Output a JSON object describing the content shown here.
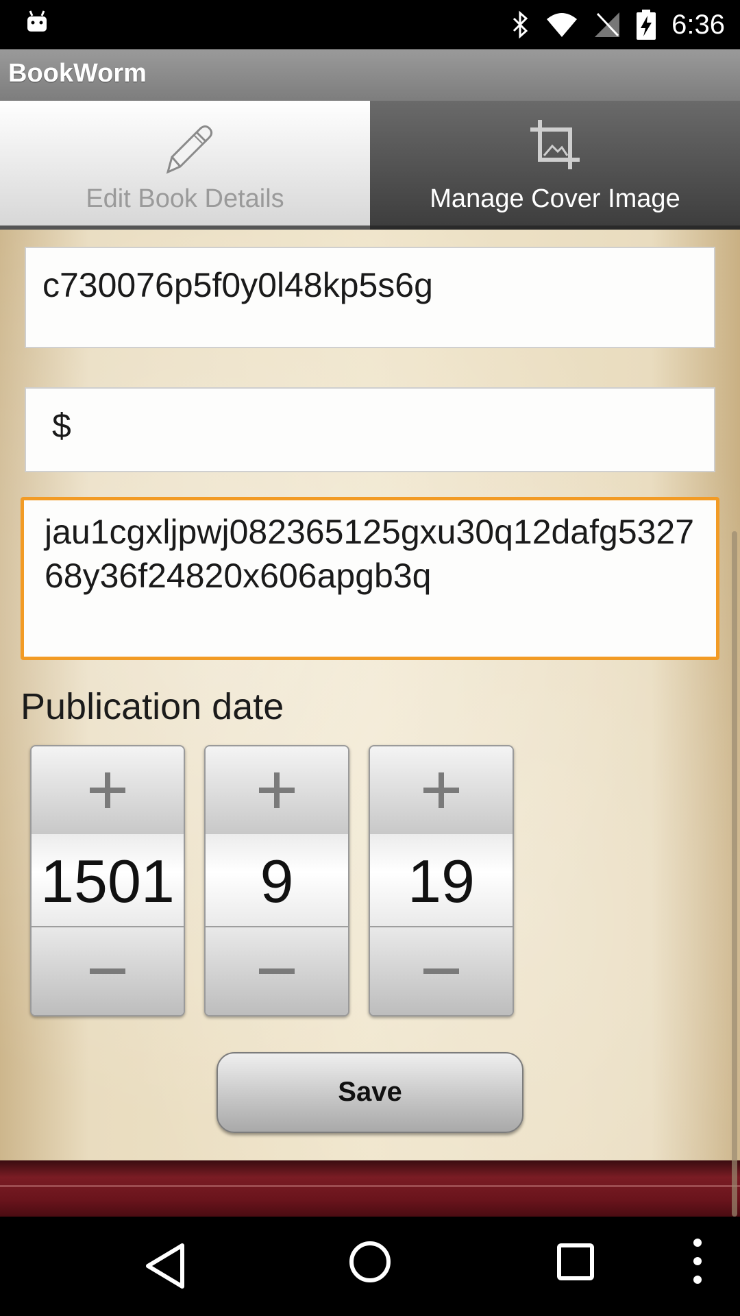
{
  "status_bar": {
    "time": "6:36",
    "icons": [
      "android-icon",
      "bluetooth-icon",
      "wifi-icon",
      "no-signal-icon",
      "battery-charging-icon"
    ]
  },
  "action_bar": {
    "title": "BookWorm"
  },
  "tabs": [
    {
      "label": "Edit Book Details",
      "icon": "pencil-icon",
      "selected": true
    },
    {
      "label": "Manage Cover Image",
      "icon": "crop-icon",
      "selected": false
    }
  ],
  "form": {
    "id_value": "c730076p5f0y0l48kp5s6g",
    "price_value": "$",
    "description_value": "jau1cgxljpwj082365125gxu30q12dafg532768y36f24820x606apgb3q",
    "publication_label": "Publication date",
    "date": {
      "year": "1501",
      "month": "9",
      "day": "19"
    },
    "save_label": "Save"
  },
  "colors": {
    "focus_border": "#f29b25",
    "shelf": "#7a1c24"
  }
}
